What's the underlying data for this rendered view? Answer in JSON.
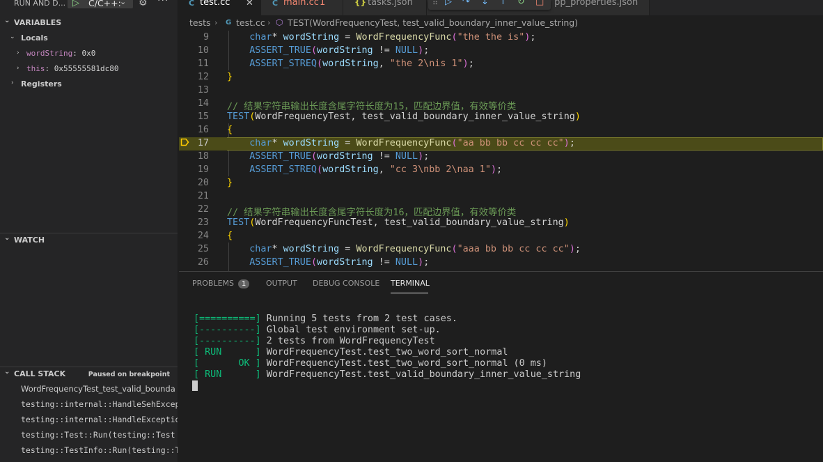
{
  "run_panel": {
    "title": "RUN AND D...",
    "config": "C/C++:",
    "icons": {
      "start": "play-icon",
      "dropdown": "chevron-down-icon",
      "settings": "gear-icon",
      "more": "ellipsis-icon"
    }
  },
  "variables": {
    "header": "VARIABLES",
    "locals_label": "Locals",
    "items": [
      {
        "name": "wordString",
        "value": "0x0"
      },
      {
        "name": "this",
        "value": "0x55555581dc80"
      }
    ],
    "registers_label": "Registers"
  },
  "watch": {
    "header": "WATCH"
  },
  "call_stack": {
    "header": "CALL STACK",
    "status": "Paused on breakpoint",
    "frames": [
      "WordFrequencyTest_test_valid_bounda",
      "testing::internal::HandleSehExcepti",
      "testing::internal::HandleExceptions",
      "testing::Test::Run(testing::Test *",
      "testing::TestInfo::Run(testing::Tes"
    ]
  },
  "tabs": [
    {
      "name": "test.cc",
      "icon": "C",
      "active": true
    },
    {
      "name": "main.cc",
      "icon": "C",
      "problems": "1"
    },
    {
      "name": "tasks.json",
      "icon": "{}"
    },
    {
      "name": "cpp_properties.json",
      "visible_text": "cpp_properties.json"
    }
  ],
  "breadcrumb": {
    "folder": "tests",
    "file": "test.cc",
    "symbol": "TEST(WordFrequencyTest, test_valid_boundary_inner_value_string)"
  },
  "editor": {
    "current_line": 17,
    "lines": [
      {
        "n": "9"
      },
      {
        "n": "10"
      },
      {
        "n": "11"
      },
      {
        "n": "12"
      },
      {
        "n": "13"
      },
      {
        "n": "14"
      },
      {
        "n": "15"
      },
      {
        "n": "16"
      },
      {
        "n": "17"
      },
      {
        "n": "18"
      },
      {
        "n": "19"
      },
      {
        "n": "20"
      },
      {
        "n": "21"
      },
      {
        "n": "22"
      },
      {
        "n": "23"
      },
      {
        "n": "24"
      },
      {
        "n": "25"
      },
      {
        "n": "26"
      }
    ],
    "text": {
      "l9_str": "\"the the is\"",
      "l11_str": "\"the 2\\nis 1\"",
      "comment1": "// 结果字符串输出长度含尾字符长度为15，匹配边界值，有效等价类",
      "l15_suite": "WordFrequencyTest",
      "l15_test": "test_valid_boundary_inner_value_string",
      "l17_str": "\"aa bb bb cc cc cc\"",
      "l19_str": "\"cc 3\\nbb 2\\naa 1\"",
      "comment2": "// 结果字符串输出长度含尾字符长度为16，匹配边界值，有效等价类",
      "l23_suite": "WordFrequencyFuncTest",
      "l23_test": "test_valid_boundary_value_string",
      "l25_str": "\"aaa bb bb cc cc cc\"",
      "type_char": "char",
      "var": "wordString",
      "func": "WordFrequencyFunc",
      "assert_true": "ASSERT_TRUE",
      "assert_streq": "ASSERT_STREQ",
      "test_macro": "TEST",
      "null": "NULL"
    }
  },
  "panel": {
    "tabs": [
      "PROBLEMS",
      "OUTPUT",
      "DEBUG CONSOLE",
      "TERMINAL"
    ],
    "problems_count": "1",
    "active_tab": "TERMINAL",
    "terminal_lines": [
      {
        "tag": "[==========]",
        "text": " Running 5 tests from 2 test cases."
      },
      {
        "tag": "[----------]",
        "text": " Global test environment set-up."
      },
      {
        "tag": "[----------]",
        "text": " 2 tests from WordFrequencyTest"
      },
      {
        "tag": "[ RUN      ]",
        "text": " WordFrequencyTest.test_two_word_sort_normal"
      },
      {
        "tag": "[       OK ]",
        "text": " WordFrequencyTest.test_two_word_sort_normal (0 ms)"
      },
      {
        "tag": "[ RUN      ]",
        "text": " WordFrequencyTest.test_valid_boundary_inner_value_string"
      }
    ]
  },
  "colors": {
    "accent_green": "#0dbc79",
    "current_line": "#4b4b18",
    "error": "#f48771"
  }
}
